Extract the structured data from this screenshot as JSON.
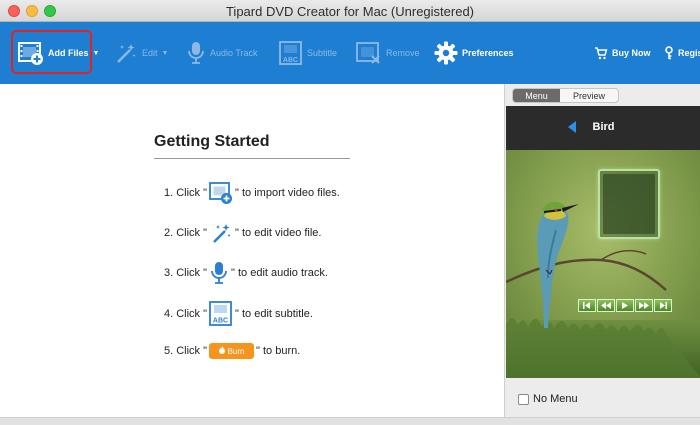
{
  "window": {
    "title": "Tipard DVD Creator for Mac (Unregistered)"
  },
  "toolbar": {
    "add_files": "Add Files",
    "edit": "Edit",
    "audio_track": "Audio Track",
    "subtitle": "Subtitle",
    "remove": "Remove",
    "preferences": "Preferences",
    "buy_now": "Buy Now",
    "register": "Regis"
  },
  "getting_started": {
    "title": "Getting Started",
    "steps": [
      {
        "prefix": "1. Click \"",
        "suffix": "\" to import video files.",
        "icon": "add-files-icon"
      },
      {
        "prefix": "2. Click \"",
        "suffix": "\" to edit video file.",
        "icon": "edit-wand-icon"
      },
      {
        "prefix": "3. Click \"",
        "suffix": "\" to edit audio track.",
        "icon": "microphone-icon"
      },
      {
        "prefix": "4. Click \"",
        "suffix": "\" to edit subtitle.",
        "icon": "subtitle-icon"
      },
      {
        "prefix": "5. Click \"",
        "suffix": "\" to burn.",
        "icon": "burn-button",
        "button": "Burn"
      }
    ]
  },
  "right_panel": {
    "tabs": [
      "Menu",
      "Preview"
    ],
    "active_tab": "Menu",
    "menu_title": "Bird",
    "no_menu_label": "No Menu",
    "no_menu_checked": false
  },
  "colors": {
    "toolbar": "#1e7ed2",
    "highlight": "#e32222",
    "burn": "#f5951e",
    "accent": "#2d8fe6"
  }
}
